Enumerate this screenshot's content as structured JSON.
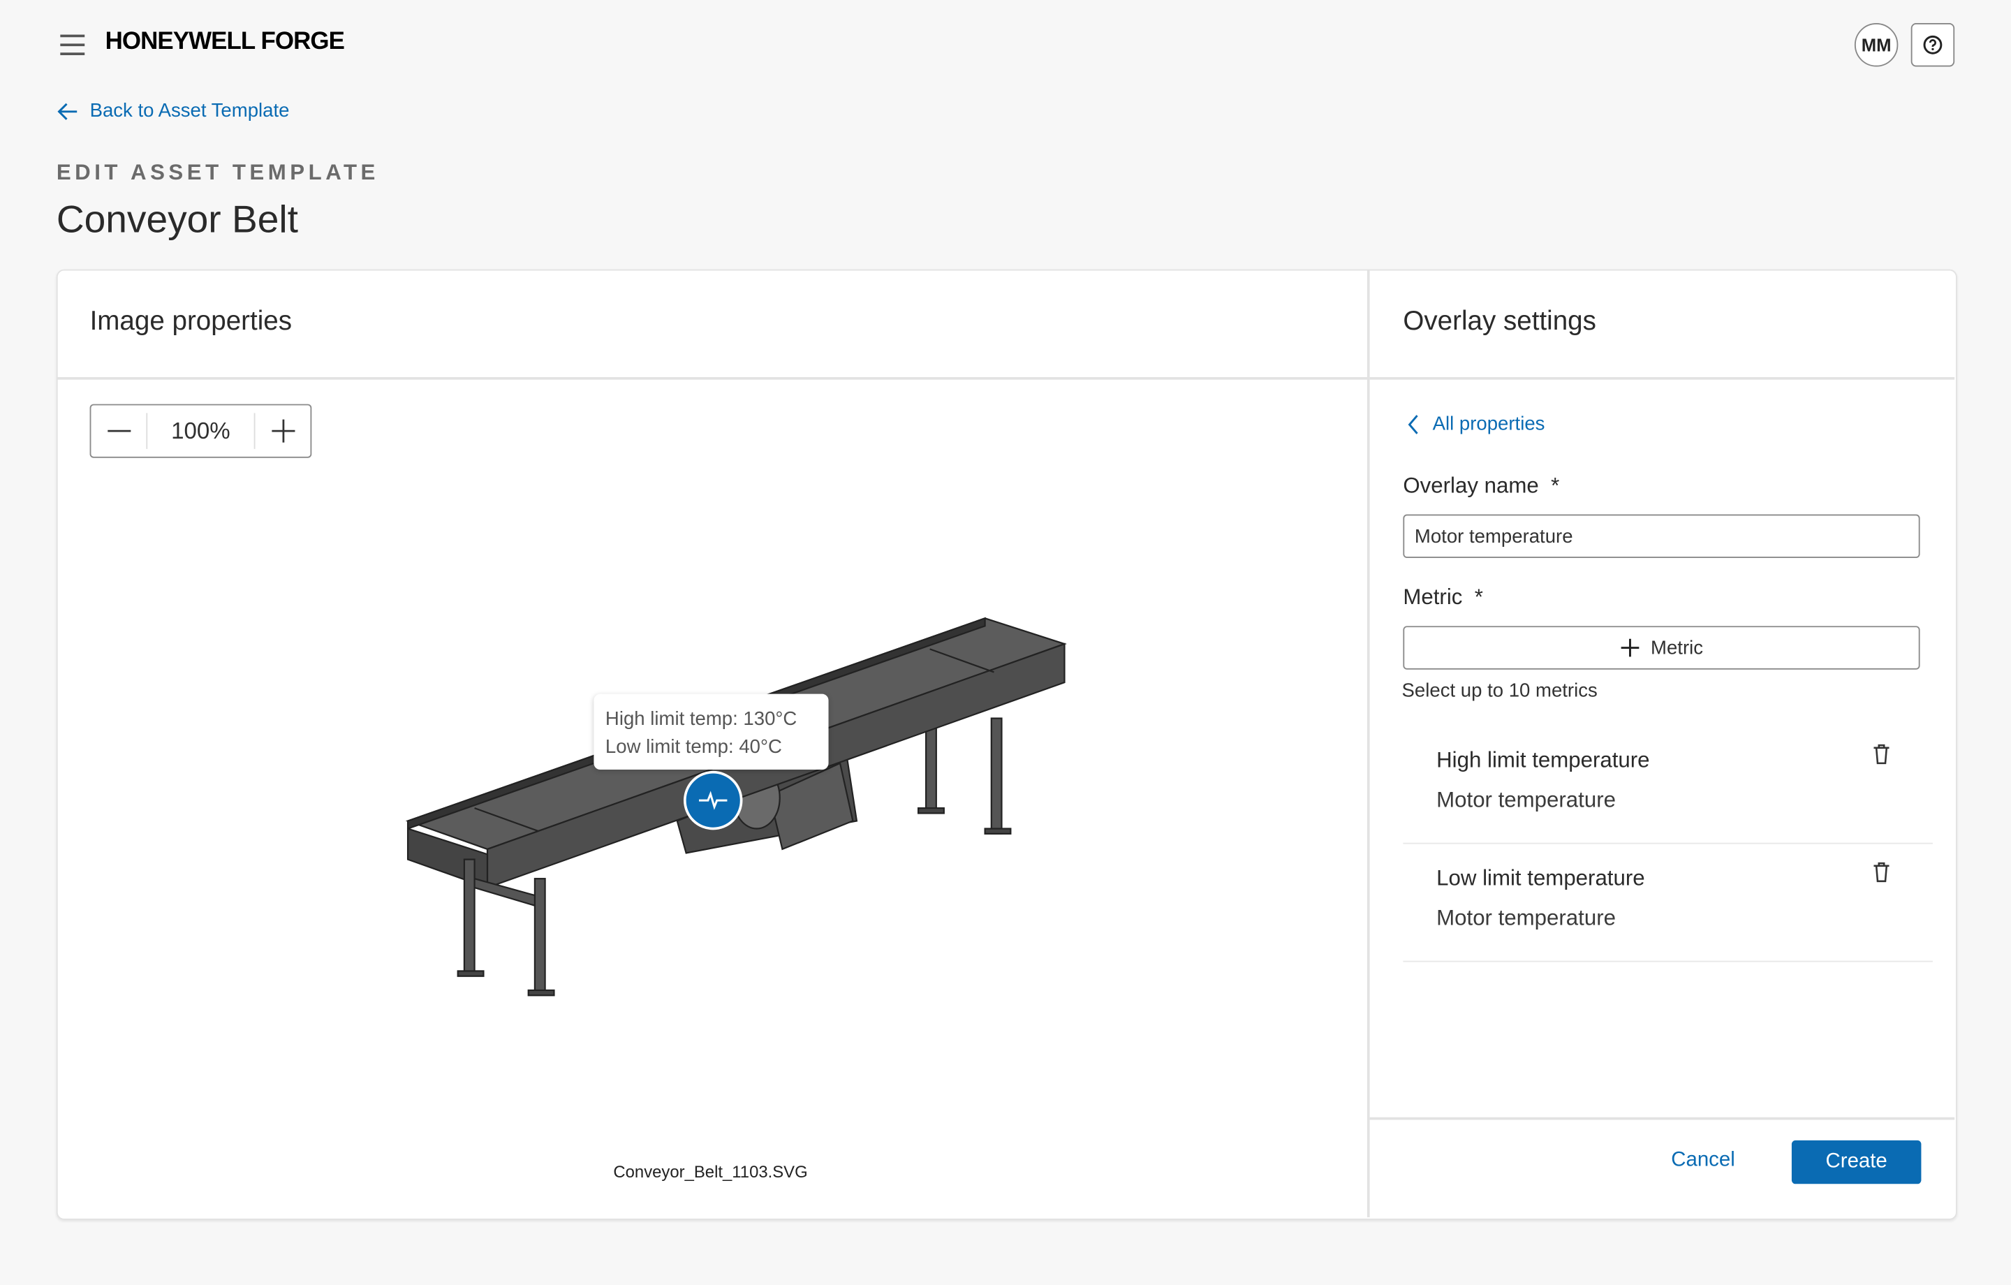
{
  "header": {
    "logo": "HONEYWELL FORGE",
    "avatar_initials": "MM",
    "menu_icon": "hamburger-icon",
    "help_icon": "help-circle-icon"
  },
  "nav": {
    "back_label": "Back to Asset Template"
  },
  "page": {
    "eyebrow": "EDIT ASSET TEMPLATE",
    "title": "Conveyor Belt"
  },
  "image_panel": {
    "title": "Image properties",
    "zoom_value": "100%",
    "tooltip": {
      "high": "High limit temp: 130°C",
      "low": "Low limit temp: 40°C"
    },
    "file_name": "Conveyor_Belt_1103.SVG"
  },
  "overlay_panel": {
    "title": "Overlay settings",
    "all_properties": "All properties",
    "overlay_name_label": "Overlay name",
    "required_mark": "*",
    "overlay_name_value": "Motor temperature",
    "metric_label": "Metric",
    "metric_button": "Metric",
    "helper": "Select up to 10 metrics",
    "metrics": [
      {
        "name": "High limit temperature",
        "source": "Motor temperature"
      },
      {
        "name": "Low limit temperature",
        "source": "Motor temperature"
      }
    ],
    "cancel": "Cancel",
    "create": "Create"
  },
  "colors": {
    "accent": "#0a6bb3",
    "background": "#f7f7f7"
  }
}
